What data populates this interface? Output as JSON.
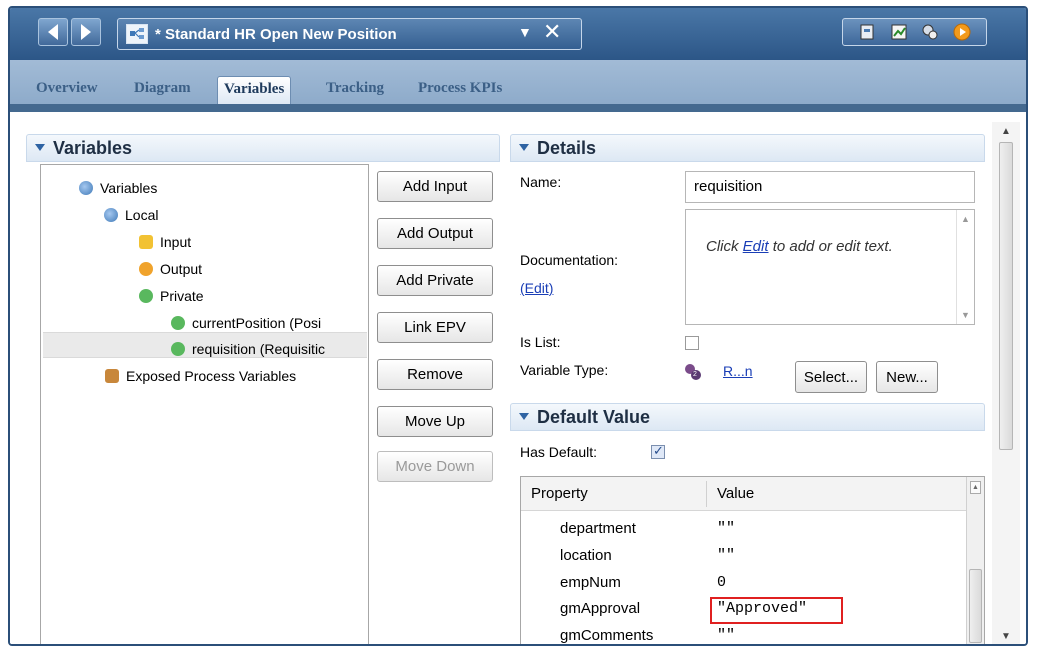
{
  "window": {
    "title": "* Standard HR Open New Position"
  },
  "tabs": [
    {
      "label": "Overview"
    },
    {
      "label": "Diagram"
    },
    {
      "label": "Variables"
    },
    {
      "label": "Tracking"
    },
    {
      "label": "Process KPIs"
    }
  ],
  "variables_panel": {
    "header": "Variables",
    "tree": {
      "root": "Variables",
      "local": "Local",
      "input": "Input",
      "output": "Output",
      "private": "Private",
      "private_items": [
        "currentPosition (Posi",
        "requisition (Requisitic"
      ],
      "exposed": "Exposed Process Variables"
    },
    "buttons": {
      "add_input": "Add Input",
      "add_output": "Add Output",
      "add_private": "Add Private",
      "link_epv": "Link EPV",
      "remove": "Remove",
      "move_up": "Move Up",
      "move_down": "Move Down"
    }
  },
  "details": {
    "header": "Details",
    "name_label": "Name:",
    "name_value": "requisition",
    "documentation_label": "Documentation:",
    "edit_link": "(Edit)",
    "doc_text_1": "Click ",
    "doc_text_edit": "Edit",
    "doc_text_2": " to add or edit text.",
    "is_list_label": "Is List:",
    "variable_type_label": "Variable Type:",
    "variable_type_value": "R...n",
    "select_button": "Select...",
    "new_button": "New..."
  },
  "default_value": {
    "header": "Default Value",
    "has_default_label": "Has Default:",
    "has_default_checked": true,
    "columns": {
      "property": "Property",
      "value": "Value"
    },
    "rows": [
      {
        "property": "department",
        "value": "\"\""
      },
      {
        "property": "location",
        "value": "\"\""
      },
      {
        "property": "empNum",
        "value": "0"
      },
      {
        "property": "gmApproval",
        "value": "\"Approved\""
      },
      {
        "property": "gmComments",
        "value": "\"\""
      }
    ]
  },
  "colors": {
    "title_bar": "#2c5687",
    "tab_bar": "#8aa8c8",
    "highlight": "#e02020",
    "link": "#1a3eb6"
  }
}
